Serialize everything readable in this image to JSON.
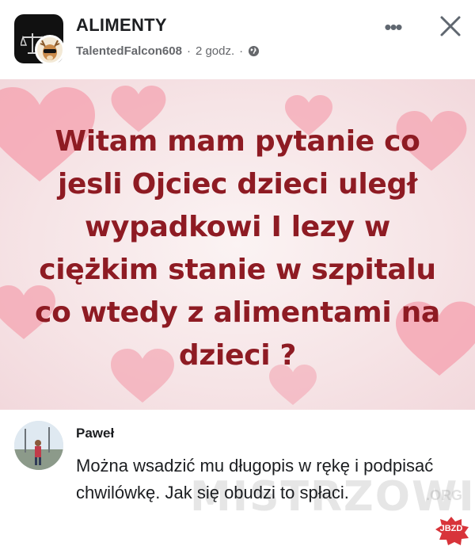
{
  "header": {
    "group_name": "ALIMENTY",
    "author": "TalentedFalcon608",
    "time": "2 godz.",
    "separator": "·",
    "more_label": "•••",
    "privacy_icon": "globe-icon",
    "close_icon": "close-icon"
  },
  "post": {
    "text": "Witam mam pytanie co jesli Ojciec dzieci uległ wypadkowi I lezy w ciężkim stanie w szpitalu co wtedy z alimentami na dzieci ?",
    "text_color": "#8e1b23",
    "background_color": "#f6e4e6",
    "heart_color": "#f4a7b4"
  },
  "comment": {
    "author": "Paweł",
    "text": "Można wsadzić mu długopis w rękę i podpisać chwilówkę. Jak się obudzi to spłaci."
  },
  "watermark": {
    "text": "MISTRZOWIE",
    "suffix": ".ORG",
    "badge": "JBZD"
  }
}
